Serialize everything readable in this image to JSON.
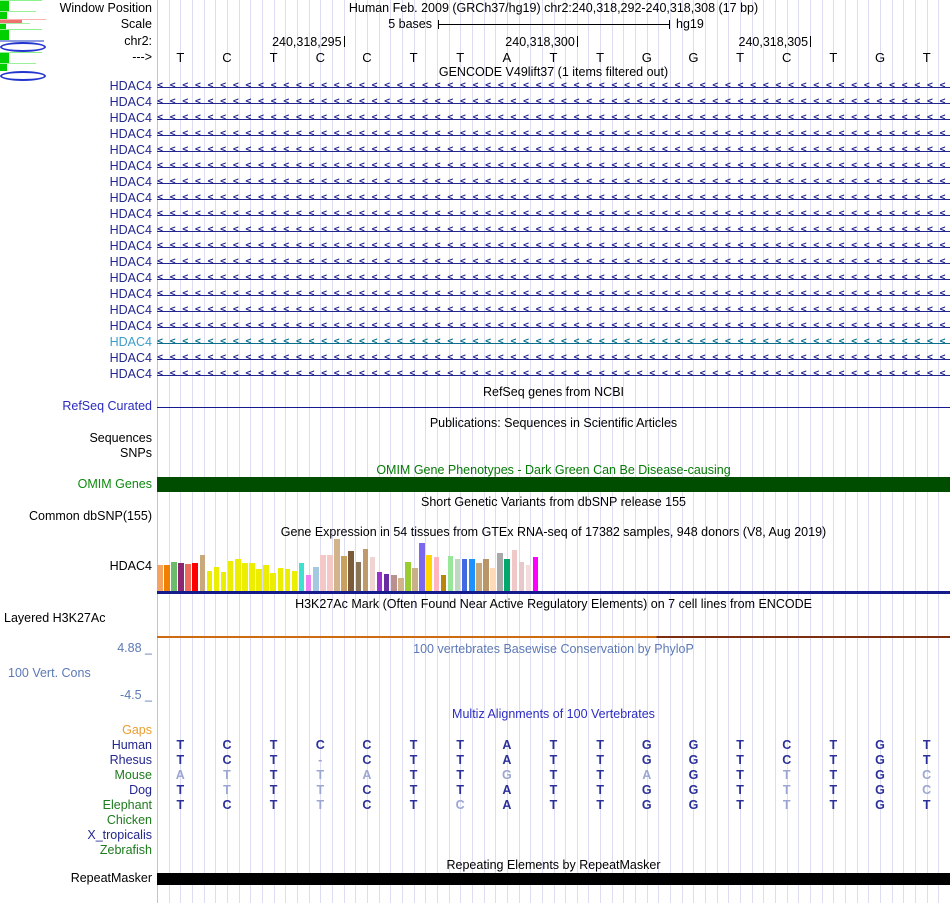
{
  "header": {
    "window_position_label": "Window Position",
    "assembly_title": "Human Feb. 2009 (GRCh37/hg19)   chr2:240,318,292-240,318,308 (17 bp)",
    "scale_label": "Scale",
    "scale_value": "5 bases",
    "assembly_short": "hg19",
    "chrom_label": "chr2:",
    "coordinates": [
      "240,318,295",
      "240,318,300",
      "240,318,305"
    ],
    "strand_label": "--->"
  },
  "sequence": {
    "bases": [
      "T",
      "C",
      "T",
      "C",
      "C",
      "T",
      "T",
      "A",
      "T",
      "T",
      "G",
      "G",
      "T",
      "C",
      "T",
      "G",
      "T"
    ]
  },
  "gencode": {
    "title": "GENCODE V49lift37 (1 items filtered out)",
    "transcripts": [
      {
        "label": "HDAC4",
        "highlighted": false
      },
      {
        "label": "HDAC4",
        "highlighted": false
      },
      {
        "label": "HDAC4",
        "highlighted": false
      },
      {
        "label": "HDAC4",
        "highlighted": false
      },
      {
        "label": "HDAC4",
        "highlighted": false
      },
      {
        "label": "HDAC4",
        "highlighted": false
      },
      {
        "label": "HDAC4",
        "highlighted": false
      },
      {
        "label": "HDAC4",
        "highlighted": false
      },
      {
        "label": "HDAC4",
        "highlighted": false
      },
      {
        "label": "HDAC4",
        "highlighted": false
      },
      {
        "label": "HDAC4",
        "highlighted": false
      },
      {
        "label": "HDAC4",
        "highlighted": false
      },
      {
        "label": "HDAC4",
        "highlighted": false
      },
      {
        "label": "HDAC4",
        "highlighted": false
      },
      {
        "label": "HDAC4",
        "highlighted": false
      },
      {
        "label": "HDAC4",
        "highlighted": false
      },
      {
        "label": "HDAC4",
        "highlighted": true
      },
      {
        "label": "HDAC4",
        "highlighted": false
      },
      {
        "label": "HDAC4",
        "highlighted": false
      }
    ]
  },
  "refseq": {
    "title": "RefSeq genes from NCBI",
    "track_label": "RefSeq Curated"
  },
  "publications": {
    "title": "Publications: Sequences in Scientific Articles",
    "sequences_label": "Sequences",
    "snps_label": "SNPs"
  },
  "omim": {
    "title": "OMIM Gene Phenotypes - Dark Green Can Be Disease-causing",
    "track_label": "OMIM Genes",
    "bar_color": "#004D00"
  },
  "dbsnp": {
    "title": "Short Genetic Variants from dbSNP release 155",
    "track_label": "Common dbSNP(155)"
  },
  "gtex": {
    "title": "Gene Expression in 54 tissues from GTEx RNA-seq of 17382 samples, 948 donors (V8, Aug 2019)",
    "track_label": "HDAC4"
  },
  "h3k27ac": {
    "title": "H3K27Ac Mark (Often Found Near Active Regulatory Elements) on 7 cell lines from ENCODE",
    "track_label": "Layered H3K27Ac"
  },
  "conservation": {
    "title": "100 vertebrates Basewise Conservation by PhyloP",
    "track_label": "100 Vert. Cons",
    "max_label": "4.88 _",
    "min_label": "-4.5 _",
    "marks": [
      {
        "col": 3,
        "type": "green-bar"
      },
      {
        "col": 7,
        "type": "green-small"
      },
      {
        "col": 8,
        "type": "red-line"
      },
      {
        "col": 9,
        "type": "green-dot"
      },
      {
        "col": 10,
        "type": "green-bar"
      },
      {
        "col": 11,
        "type": "blue-line"
      },
      {
        "col": 12,
        "type": "blue-ellipse"
      },
      {
        "col": 13,
        "type": "green-bar"
      },
      {
        "col": 15,
        "type": "green-small"
      },
      {
        "col": 16,
        "type": "blue-ellipse"
      }
    ]
  },
  "multiz": {
    "title": "Multiz Alignments of 100 Vertebrates",
    "rows": [
      {
        "name": "Gaps",
        "color": "orange",
        "seq": null,
        "dim": []
      },
      {
        "name": "Human",
        "color": "navy",
        "seq": "TCTCCTTATTGGTCTGT",
        "dim": []
      },
      {
        "name": "Rhesus",
        "color": "navy",
        "seq": "TCT-CTTATTGGTCTGT",
        "dim": [
          4
        ]
      },
      {
        "name": "Mouse",
        "color": "green",
        "seq": "ATTTATTGTTAGTTTGC",
        "dim": [
          1,
          2,
          4,
          5,
          8,
          11,
          14,
          17
        ]
      },
      {
        "name": "Dog",
        "color": "navy",
        "seq": "TTTTCTTATTGGTTTGC",
        "dim": [
          2,
          4,
          14,
          17
        ]
      },
      {
        "name": "Elephant",
        "color": "green",
        "seq": "TCTTCTCATTGGTTTGT",
        "dim": [
          4,
          7,
          14
        ]
      },
      {
        "name": "Chicken",
        "color": "green",
        "seq": null,
        "dim": []
      },
      {
        "name": "X_tropicalis",
        "color": "navy",
        "seq": null,
        "dim": []
      },
      {
        "name": "Zebrafish",
        "color": "green",
        "seq": null,
        "dim": []
      }
    ]
  },
  "repeatmasker": {
    "title": "Repeating Elements by RepeatMasker",
    "track_label": "RepeatMasker",
    "bar_color": "#000000"
  },
  "colors": {
    "gene_navy": "#23268E",
    "gene_teal_line": "#0A6E8C",
    "gene_teal_label": "#3E9DCB",
    "refseq_line": "#151B8C",
    "gtex_baseline": "#151B8C",
    "h3k27ac_line_left": "#CE6A10",
    "h3k27ac_line_right": "#7E2D10",
    "gridline": "#DCDCF2",
    "gridline_first": "#FFABAB"
  },
  "chart_data": {
    "type": "bar",
    "title": "Gene Expression in 54 tissues from GTEx RNA-seq of 17382 samples, 948 donors (V8, Aug 2019)",
    "gene": "HDAC4",
    "unit": "track pixels above baseline",
    "bars": [
      {
        "color": "#F4A460",
        "h": 26
      },
      {
        "color": "#F08000",
        "h": 26
      },
      {
        "color": "#6BBB6B",
        "h": 29
      },
      {
        "color": "#8B2670",
        "h": 28
      },
      {
        "color": "#EE6A5A",
        "h": 27
      },
      {
        "color": "#FF0000",
        "h": 28
      },
      {
        "color": "#C9A97B",
        "h": 36
      },
      {
        "color": "#EDED00",
        "h": 20
      },
      {
        "color": "#EDED00",
        "h": 24
      },
      {
        "color": "#EDED00",
        "h": 19
      },
      {
        "color": "#EDED00",
        "h": 30
      },
      {
        "color": "#EDED00",
        "h": 32
      },
      {
        "color": "#EDED00",
        "h": 28
      },
      {
        "color": "#EDED00",
        "h": 28
      },
      {
        "color": "#EDED00",
        "h": 22
      },
      {
        "color": "#EDED00",
        "h": 26
      },
      {
        "color": "#EDED00",
        "h": 18
      },
      {
        "color": "#EDED00",
        "h": 23
      },
      {
        "color": "#EDED00",
        "h": 22
      },
      {
        "color": "#EDED00",
        "h": 20
      },
      {
        "color": "#3FE0D0",
        "h": 28
      },
      {
        "color": "#EE82EE",
        "h": 16
      },
      {
        "color": "#A6C9E2",
        "h": 24
      },
      {
        "color": "#F5C8C8",
        "h": 36
      },
      {
        "color": "#F5C8C8",
        "h": 36
      },
      {
        "color": "#D2B48C",
        "h": 52
      },
      {
        "color": "#C8A060",
        "h": 35
      },
      {
        "color": "#7B5B3A",
        "h": 40
      },
      {
        "color": "#8B7355",
        "h": 29
      },
      {
        "color": "#C19A6B",
        "h": 42
      },
      {
        "color": "#EFD5D2",
        "h": 34
      },
      {
        "color": "#9932CC",
        "h": 19
      },
      {
        "color": "#6A2DA0",
        "h": 17
      },
      {
        "color": "#BC8F8F",
        "h": 16
      },
      {
        "color": "#D2B48C",
        "h": 13
      },
      {
        "color": "#9ACD32",
        "h": 29
      },
      {
        "color": "#C8B088",
        "h": 23
      },
      {
        "color": "#7B68EE",
        "h": 48
      },
      {
        "color": "#FFD700",
        "h": 36
      },
      {
        "color": "#FFB6C1",
        "h": 34
      },
      {
        "color": "#B8860B",
        "h": 16
      },
      {
        "color": "#98E698",
        "h": 35
      },
      {
        "color": "#C0D8C0",
        "h": 32
      },
      {
        "color": "#4169E1",
        "h": 32
      },
      {
        "color": "#1E90FF",
        "h": 32
      },
      {
        "color": "#C8A878",
        "h": 28
      },
      {
        "color": "#B89668",
        "h": 32
      },
      {
        "color": "#FFDAB9",
        "h": 23
      },
      {
        "color": "#A9A9A9",
        "h": 38
      },
      {
        "color": "#00A86B",
        "h": 32
      },
      {
        "color": "#F0C8C8",
        "h": 41
      },
      {
        "color": "#E8C8C8",
        "h": 29
      },
      {
        "color": "#F5DCDC",
        "h": 26
      },
      {
        "color": "#FF00FF",
        "h": 34
      }
    ]
  }
}
